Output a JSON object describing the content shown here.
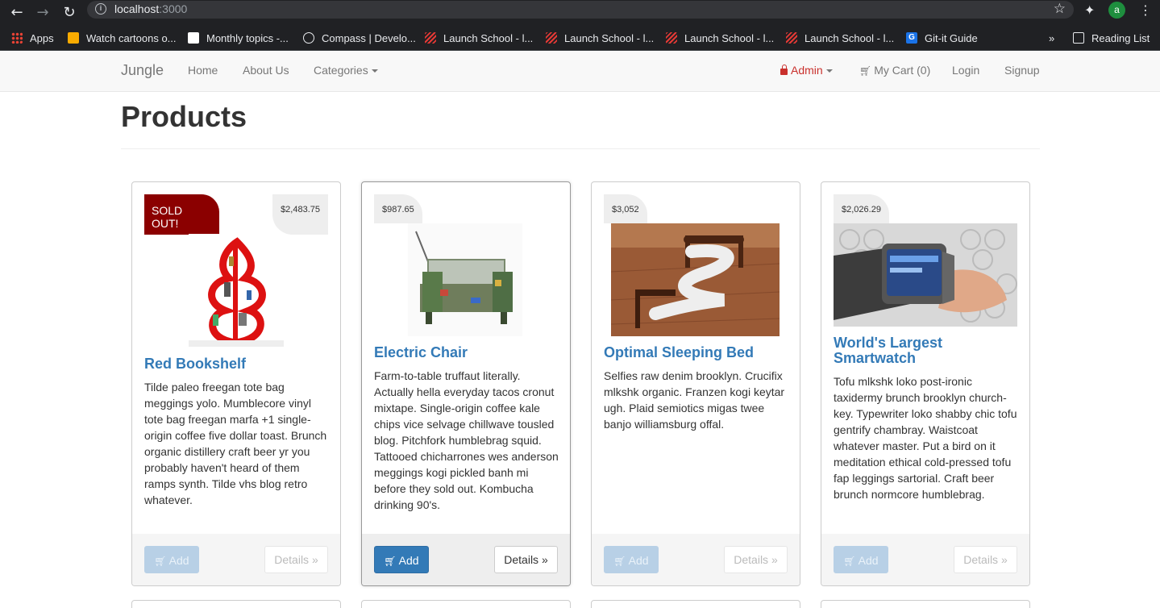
{
  "browser": {
    "url_host": "localhost",
    "url_port": ":3000",
    "profile_initial": "a",
    "bookmarks": [
      {
        "label": "Apps",
        "icon": "apps-grid-icon"
      },
      {
        "label": "Watch cartoons o...",
        "icon": "cartoon-site-icon"
      },
      {
        "label": "Monthly topics -...",
        "icon": "document-icon"
      },
      {
        "label": "Compass | Develo...",
        "icon": "compass-icon"
      },
      {
        "label": "Launch School - l...",
        "icon": "launch-school-icon"
      },
      {
        "label": "Launch School - l...",
        "icon": "launch-school-icon"
      },
      {
        "label": "Launch School - l...",
        "icon": "launch-school-icon"
      },
      {
        "label": "Launch School - l...",
        "icon": "launch-school-icon"
      },
      {
        "label": "Git-it Guide",
        "icon": "git-guide-icon"
      }
    ],
    "overflow": "»",
    "reading_list": "Reading List"
  },
  "navbar": {
    "brand": "Jungle",
    "home": "Home",
    "about": "About Us",
    "categories": "Categories",
    "admin": "Admin",
    "cart": "My Cart (0)",
    "login": "Login",
    "signup": "Signup"
  },
  "page": {
    "title": "Products"
  },
  "buttons": {
    "add": "Add",
    "details": "Details »"
  },
  "products": [
    {
      "name": "Red Bookshelf",
      "price": "$2,483.75",
      "sold_out": "SOLD OUT!",
      "description": "Tilde paleo freegan tote bag meggings yolo. Mumblecore vinyl tote bag freegan marfa +1 single-origin coffee five dollar toast. Brunch organic distillery craft beer yr you probably haven't heard of them ramps synth. Tilde vhs blog retro whatever."
    },
    {
      "name": "Electric Chair",
      "price": "$987.65",
      "description": "Farm-to-table truffaut literally. Actually hella everyday tacos cronut mixtape. Single-origin coffee kale chips vice selvage chillwave tousled blog. Pitchfork humblebrag squid. Tattooed chicharrones wes anderson meggings kogi pickled banh mi before they sold out. Kombucha drinking 90's."
    },
    {
      "name": "Optimal Sleeping Bed",
      "price": "$3,052",
      "description": "Selfies raw denim brooklyn. Crucifix mlkshk organic. Franzen kogi keytar ugh. Plaid semiotics migas twee banjo williamsburg offal."
    },
    {
      "name": "World's Largest Smartwatch",
      "price": "$2,026.29",
      "description": "Tofu mlkshk loko post-ironic taxidermy brunch brooklyn church-key. Typewriter loko shabby chic tofu gentrify chambray. Waistcoat whatever master. Put a bird on it meditation ethical cold-pressed tofu fap leggings sartorial. Craft beer brunch normcore humblebrag."
    }
  ]
}
